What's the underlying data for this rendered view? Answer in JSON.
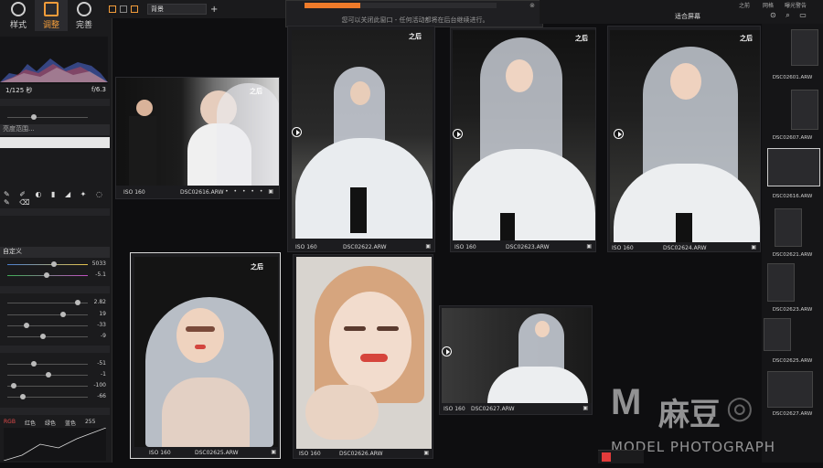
{
  "toolbar_tabs": [
    {
      "label": "样式"
    },
    {
      "label": "调整"
    },
    {
      "label": "完善"
    }
  ],
  "left_panel": {
    "shutter": "1/125 秒",
    "aperture": "f/6.3",
    "mask_option": "亮度范围...",
    "preset_label": "自定义",
    "wb_values": [
      "5033",
      "-5.1"
    ],
    "tone_values": [
      "2.82",
      "19",
      "-33",
      "-9"
    ],
    "hsl_values": [
      "-51",
      "-1",
      "-100",
      "-66"
    ],
    "curve_tabs": [
      "RGB",
      "红色",
      "绿色",
      "蓝色"
    ],
    "curve_value": "255"
  },
  "top_toolbar": {
    "filter_label": "背景",
    "add_label": "+"
  },
  "notice": {
    "text": "您可以关闭此窗口 - 任何活动都将在后台继续进行。",
    "progress": 0.29
  },
  "top_right": {
    "fit_label": "适合屏幕",
    "menu": [
      "之前",
      "网格",
      "曝光警告"
    ]
  },
  "thumbnails": [
    {
      "after": "之后",
      "iso": "ISO 160",
      "file": "DSC02616.ARW"
    },
    {
      "after": "之后",
      "iso": "ISO 160",
      "file": "DSC02622.ARW"
    },
    {
      "after": "之后",
      "iso": "ISO 160",
      "file": "DSC02623.ARW"
    },
    {
      "after": "之后",
      "iso": "ISO 160",
      "file": "DSC02624.ARW"
    },
    {
      "after": "之后",
      "iso": "ISO 160",
      "file": "DSC02625.ARW"
    },
    {
      "after": "",
      "iso": "ISO 160",
      "file": "DSC02626.ARW"
    },
    {
      "after": "",
      "iso": "ISO 160",
      "file": "DSC02627.ARW"
    }
  ],
  "filmstrip": [
    "DSC02601.ARW",
    "DSC02607.ARW",
    "DSC02616.ARW",
    "DSC02621.ARW",
    "DSC02623.ARW",
    "DSC02624.ARW",
    "DSC02625.ARW",
    "DSC02627.ARW"
  ],
  "watermark": {
    "brand": "麻豆",
    "sub": "MODEL PHOTOGRAPH"
  }
}
